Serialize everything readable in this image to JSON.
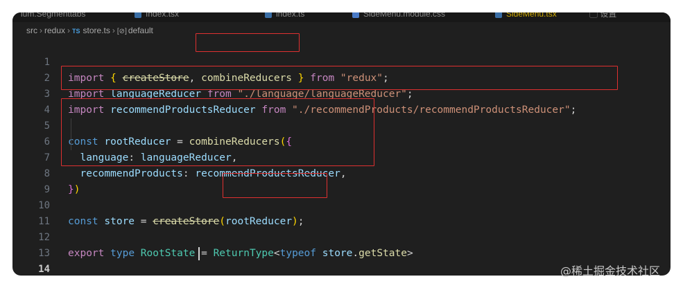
{
  "tabs": [
    {
      "label": "ium.Segmenttabs"
    },
    {
      "label": "Index.tsx"
    },
    {
      "label": "index.ts"
    },
    {
      "label": "SideMenu.module.css"
    },
    {
      "label": "SideMenu.tsx"
    },
    {
      "label": "设置"
    }
  ],
  "breadcrumb": {
    "parts": [
      "src",
      "redux",
      "store.ts",
      "default"
    ],
    "file_icon": "TS",
    "symbol_icon": "[⊘]"
  },
  "editor": {
    "line_numbers": [
      "1",
      "2",
      "3",
      "4",
      "5",
      "6",
      "7",
      "8",
      "9",
      "10",
      "11",
      "12",
      "13",
      "14"
    ],
    "current_line": 14
  },
  "watermark": "@稀土掘金技术社区"
}
